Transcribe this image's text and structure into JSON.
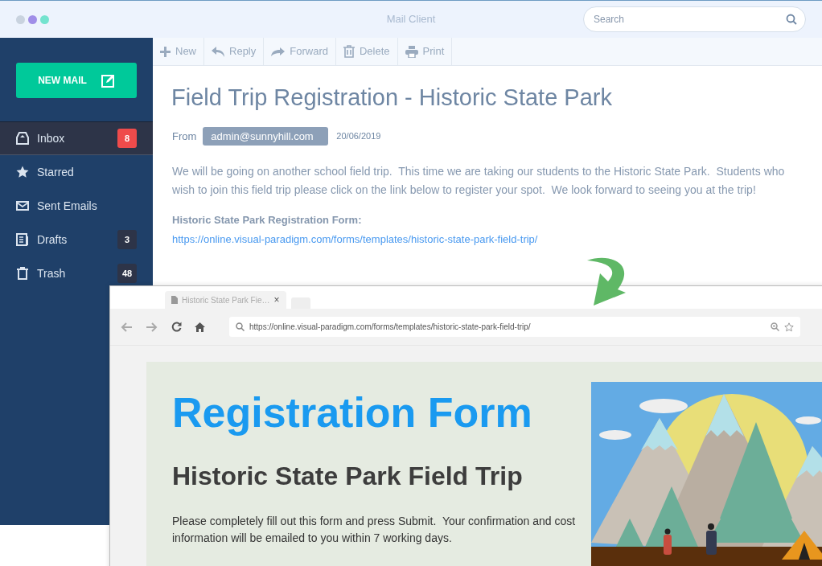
{
  "window": {
    "title": "Mail Client"
  },
  "search": {
    "placeholder": "Search"
  },
  "sidebar": {
    "new_mail_button": "NEW MAIL",
    "items": [
      {
        "label": "Inbox",
        "kind": "inbox",
        "count": "8",
        "color": "#ef4b4b",
        "selected": true
      },
      {
        "label": "Starred",
        "kind": "star",
        "selected": false
      },
      {
        "label": "Sent Emails",
        "kind": "mail",
        "selected": false
      },
      {
        "label": "Drafts",
        "kind": "drafts",
        "count": "3",
        "color": "#2d3448",
        "selected": false
      },
      {
        "label": "Trash",
        "kind": "trash",
        "count": "48",
        "color": "#2d3448",
        "selected": false
      }
    ]
  },
  "toolbar": [
    {
      "label": "New",
      "kind": "new"
    },
    {
      "label": "Reply",
      "kind": "reply"
    },
    {
      "label": "Forward",
      "kind": "forward"
    },
    {
      "label": "Delete",
      "kind": "delete"
    },
    {
      "label": "Print",
      "kind": "print"
    }
  ],
  "email": {
    "subject": "Field Trip Registration - Historic State Park",
    "from_label": "From",
    "sender": "admin@sunnyhill.com",
    "date": "20/06/2019",
    "body": "We will be going on another school field trip.  This time we are taking our students to the Historic State Park.  Students who wish to join this field trip please click on the link below to register your spot.  We look forward to seeing you at the trip!",
    "link_heading": "Historic State Park Registration Form:",
    "link": "https://online.visual-paradigm.com/forms/templates/historic-state-park-field-trip/"
  },
  "browser": {
    "tab_title": "Historic State Park Fie…",
    "close": "×",
    "url": "https://online.visual-paradigm.com/forms/templates/historic-state-park-field-trip/",
    "page": {
      "heading": "Registration Form",
      "subheading": "Historic State Park Field Trip",
      "text": "Please completely fill out this form and press Submit.  Your confirmation and cost information will be emailed to you within 7 working days."
    }
  }
}
